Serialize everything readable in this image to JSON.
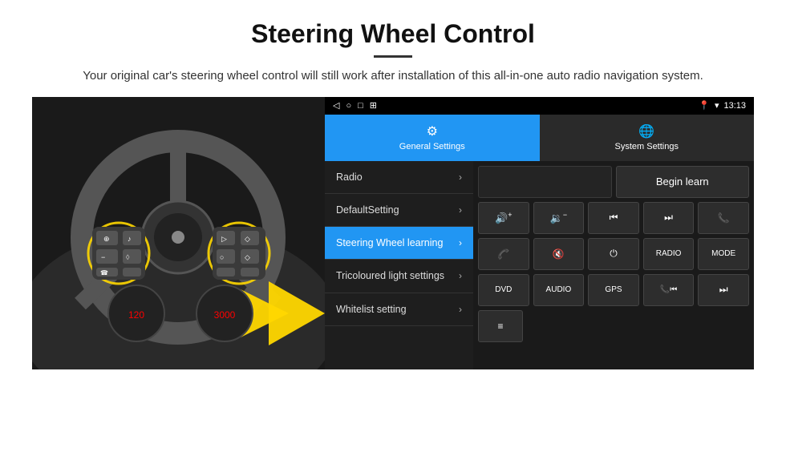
{
  "header": {
    "title": "Steering Wheel Control",
    "divider": true,
    "subtitle": "Your original car's steering wheel control will still work after installation of this all-in-one auto radio navigation system."
  },
  "status_bar": {
    "time": "13:13",
    "left_icons": [
      "◁",
      "○",
      "□",
      "⊞"
    ],
    "right_icons": [
      "📍",
      "▾",
      "📶"
    ]
  },
  "tabs": [
    {
      "id": "general",
      "label": "General Settings",
      "icon": "⚙",
      "active": true
    },
    {
      "id": "system",
      "label": "System Settings",
      "icon": "🌐",
      "active": false
    }
  ],
  "menu_items": [
    {
      "id": "radio",
      "label": "Radio",
      "active": false
    },
    {
      "id": "default",
      "label": "DefaultSetting",
      "active": false
    },
    {
      "id": "steering",
      "label": "Steering Wheel learning",
      "active": true
    },
    {
      "id": "tricoloured",
      "label": "Tricoloured light settings",
      "active": false
    },
    {
      "id": "whitelist",
      "label": "Whitelist setting",
      "active": false
    }
  ],
  "controls": {
    "begin_learn_label": "Begin learn",
    "buttons_row1": [
      {
        "id": "vol-up",
        "icon": "🔊+",
        "text": "◀+",
        "unicode": "🔊"
      },
      {
        "id": "vol-down",
        "icon": "🔉",
        "text": "◀-",
        "unicode": "🔉"
      },
      {
        "id": "prev-track",
        "text": "⏮"
      },
      {
        "id": "next-track",
        "text": "⏭"
      },
      {
        "id": "phone",
        "text": "📞"
      }
    ],
    "buttons_row2": [
      {
        "id": "answer",
        "text": "📞"
      },
      {
        "id": "mute",
        "text": "🔇"
      },
      {
        "id": "power",
        "text": "⏻"
      },
      {
        "id": "radio-btn",
        "text": "RADIO"
      },
      {
        "id": "mode",
        "text": "MODE"
      }
    ],
    "buttons_row3": [
      {
        "id": "dvd",
        "text": "DVD"
      },
      {
        "id": "audio",
        "text": "AUDIO"
      },
      {
        "id": "gps",
        "text": "GPS"
      },
      {
        "id": "tel-prev",
        "text": "📞⏮"
      },
      {
        "id": "skip-next",
        "text": "⏭"
      }
    ],
    "buttons_row4": [
      {
        "id": "special",
        "text": "≡"
      }
    ]
  }
}
